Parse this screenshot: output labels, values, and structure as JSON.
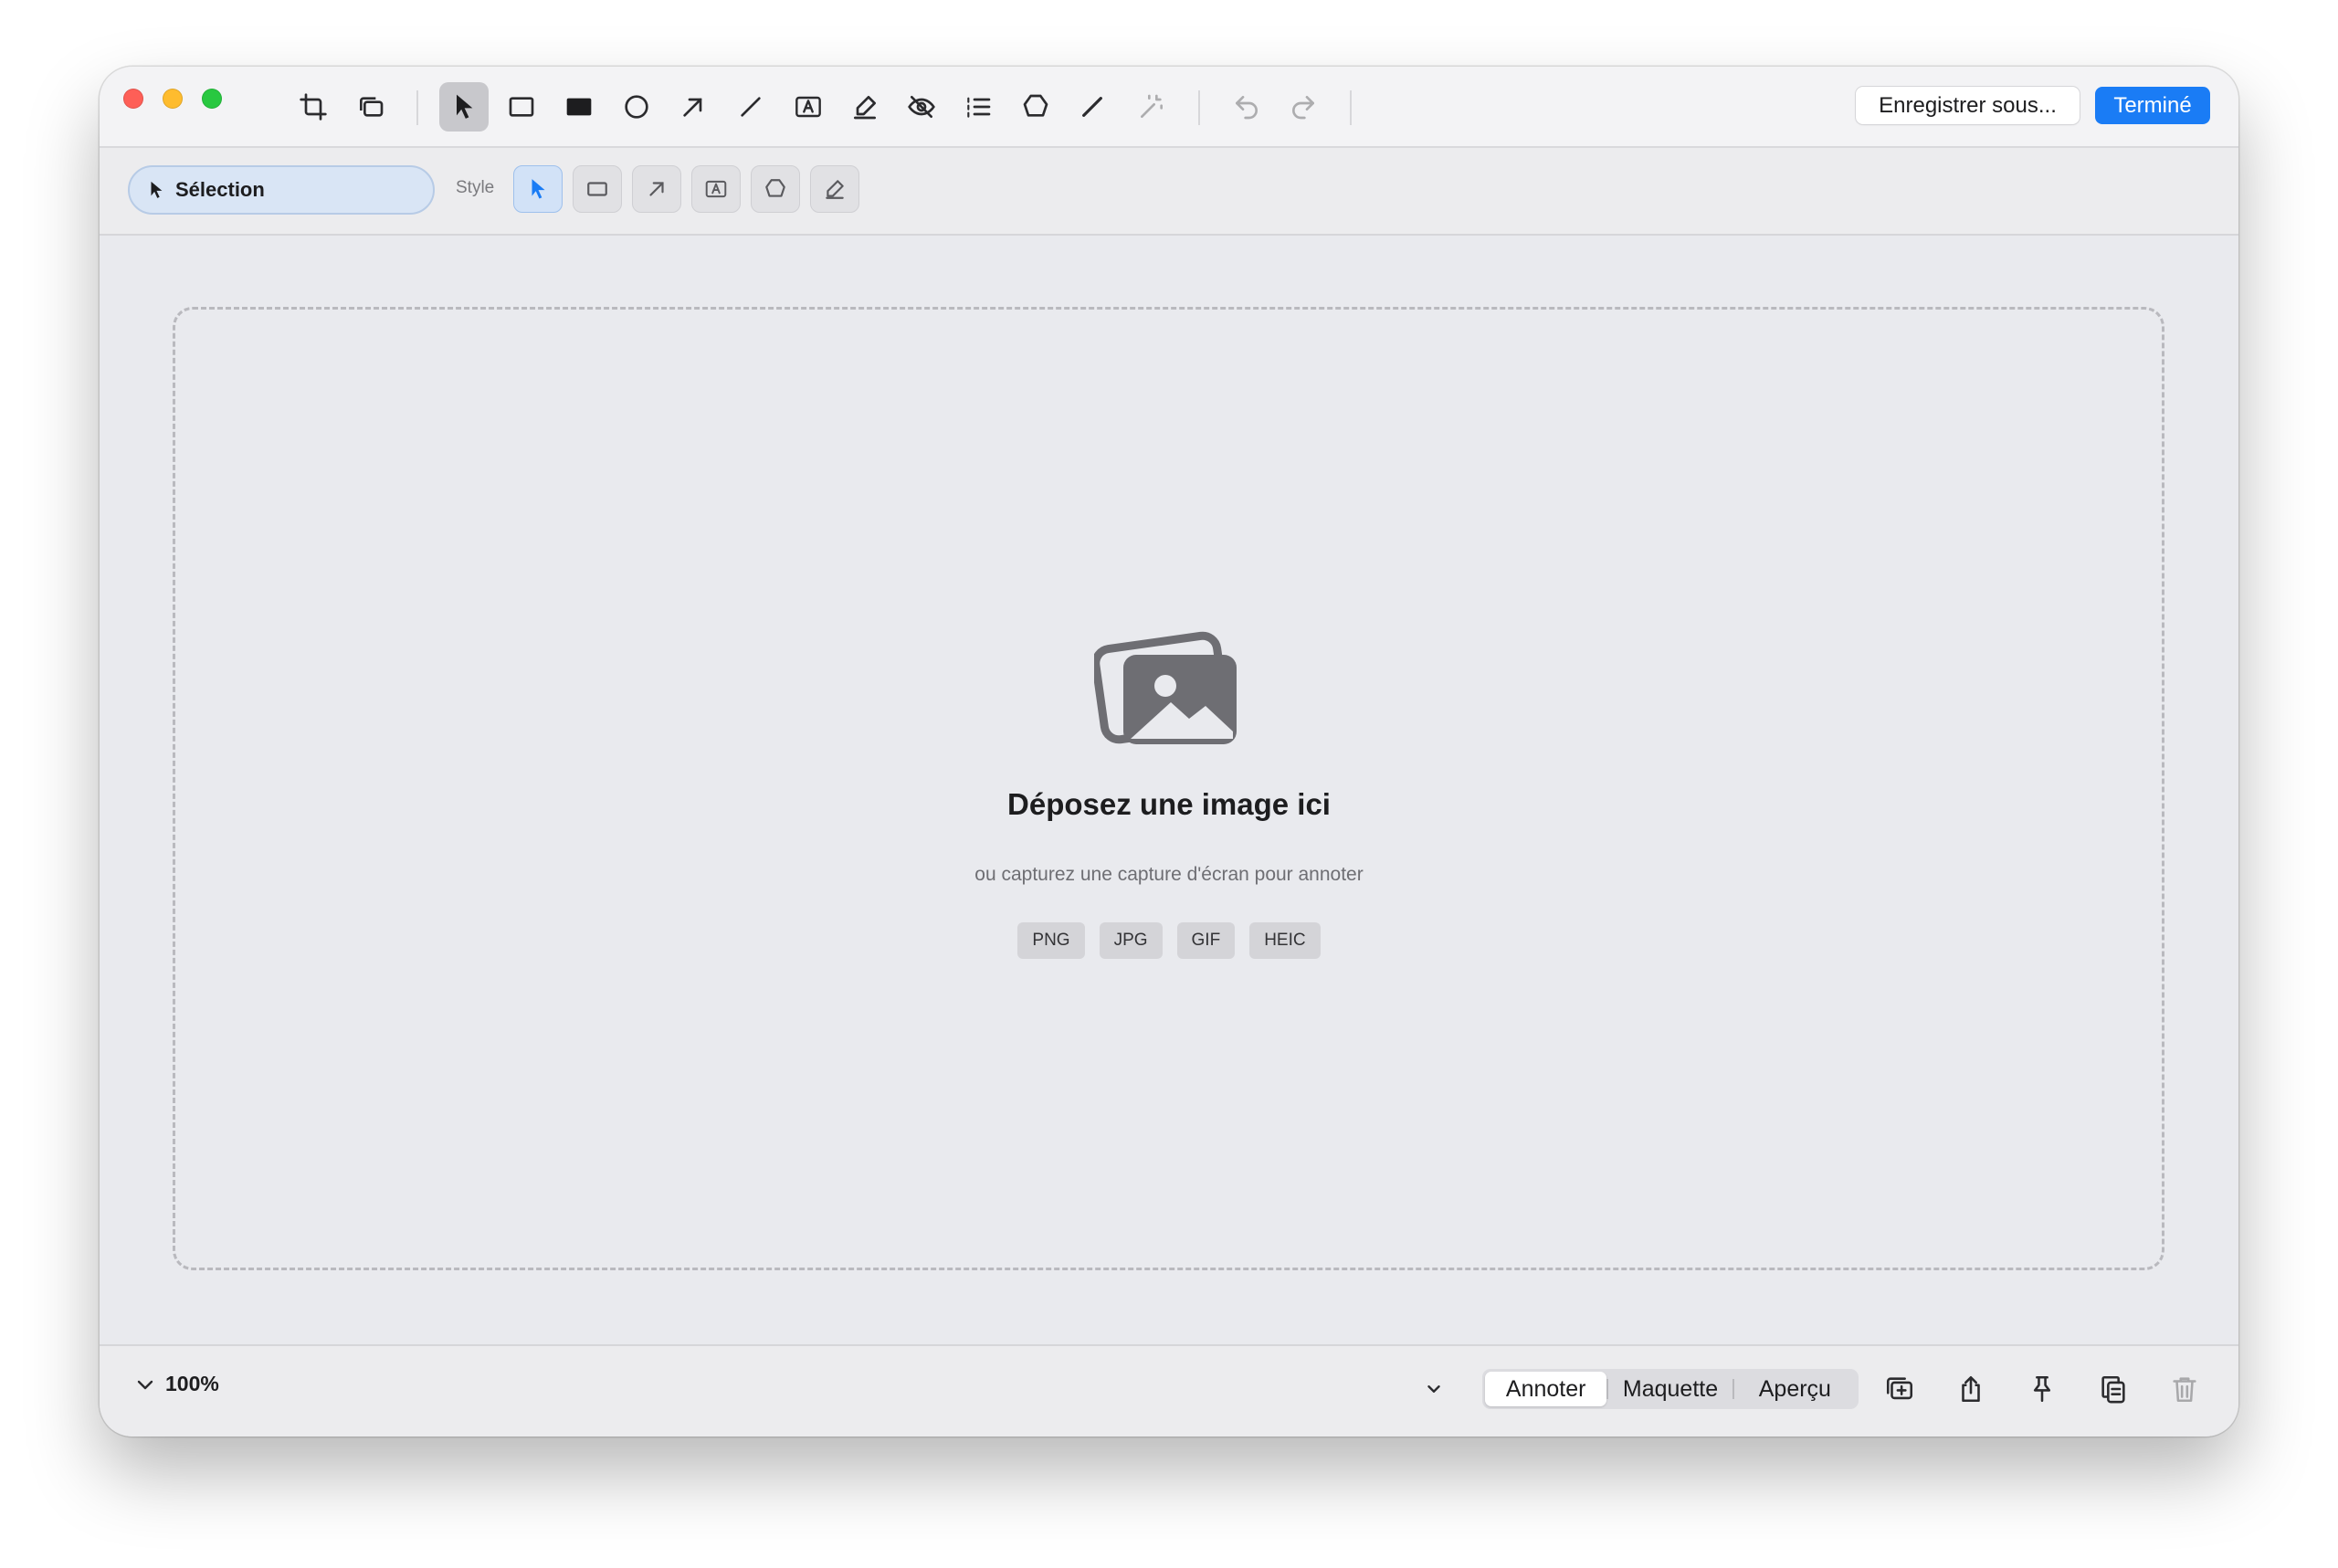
{
  "toolbar": {
    "save_as_label": "Enregistrer sous...",
    "done_label": "Terminé",
    "accent_color": "#1a7cf5",
    "tools": [
      "crop-icon",
      "layers-icon",
      "pointer-icon",
      "rectangle-icon",
      "filled-rectangle-icon",
      "ellipse-icon",
      "arrow-icon",
      "line-icon",
      "text-box-icon",
      "highlighter-icon",
      "blur-eye-icon",
      "numbered-list-icon",
      "polygon-icon",
      "pen-icon",
      "magic-wand-icon",
      "undo-icon",
      "redo-icon"
    ]
  },
  "subtoolbar": {
    "selection_label": "Sélection",
    "style_label": "Style",
    "style_tools": [
      "pointer-icon",
      "rectangle-icon",
      "arrow-icon",
      "text-box-icon",
      "polygon-icon",
      "pencil-icon"
    ]
  },
  "dropzone": {
    "title": "Déposez une image ici",
    "subtitle": "ou capturez une capture d'écran pour annoter",
    "formats": [
      "PNG",
      "JPG",
      "GIF",
      "HEIC"
    ]
  },
  "bottombar": {
    "zoom": "100%",
    "modes": [
      "Annoter",
      "Maquette",
      "Aperçu"
    ],
    "selected_mode": "Annoter",
    "actions": [
      "add-canvas-icon",
      "share-icon",
      "pin-icon",
      "copy-icon",
      "trash-icon"
    ]
  }
}
